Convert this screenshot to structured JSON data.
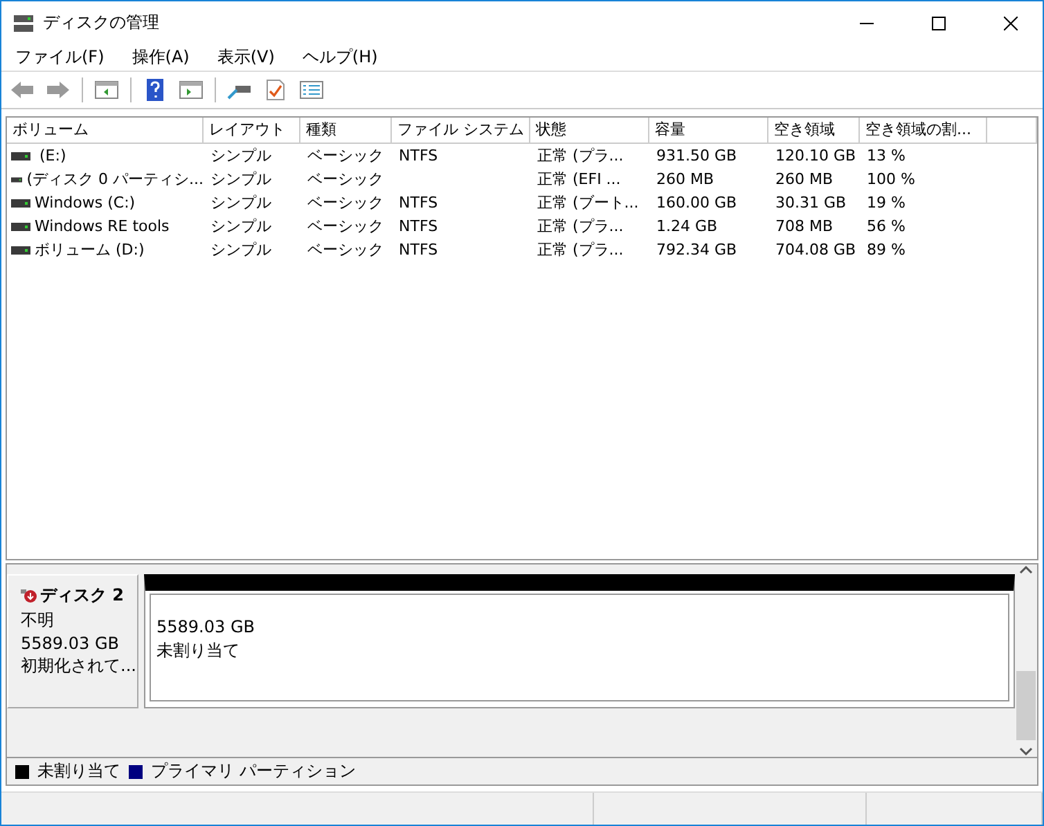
{
  "window": {
    "title": "ディスクの管理"
  },
  "menu": [
    "ファイル(F)",
    "操作(A)",
    "表示(V)",
    "ヘルプ(H)"
  ],
  "table": {
    "columns": [
      "ボリューム",
      "レイアウト",
      "種類",
      "ファイル システム",
      "状態",
      "容量",
      "空き領域",
      "空き領域の割..."
    ],
    "rows": [
      {
        "cells": [
          " (E:)",
          "シンプル",
          "ベーシック",
          "NTFS",
          "正常 (プラ...",
          "931.50 GB",
          "120.10 GB",
          "13 %"
        ]
      },
      {
        "cells": [
          "(ディスク 0 パーティシ...",
          "シンプル",
          "ベーシック",
          "",
          "正常 (EFI ...",
          "260 MB",
          "260 MB",
          "100 %"
        ]
      },
      {
        "cells": [
          "Windows (C:)",
          "シンプル",
          "ベーシック",
          "NTFS",
          "正常 (ブート...",
          "160.00 GB",
          "30.31 GB",
          "19 %"
        ]
      },
      {
        "cells": [
          "Windows RE tools",
          "シンプル",
          "ベーシック",
          "NTFS",
          "正常 (プラ...",
          "1.24 GB",
          "708 MB",
          "56 %"
        ]
      },
      {
        "cells": [
          "ボリューム (D:)",
          "シンプル",
          "ベーシック",
          "NTFS",
          "正常 (プラ...",
          "792.34 GB",
          "704.08 GB",
          "89 %"
        ]
      }
    ]
  },
  "disk": {
    "name": "ディスク 2",
    "status": "不明",
    "size": "5589.03 GB",
    "state": "初期化されて...",
    "partition": {
      "size": "5589.03 GB",
      "label": "未割り当て",
      "color": "#000000"
    }
  },
  "legend": [
    {
      "label": "未割り当て",
      "color": "#000000"
    },
    {
      "label": "プライマリ パーティション",
      "color": "#000080"
    }
  ]
}
